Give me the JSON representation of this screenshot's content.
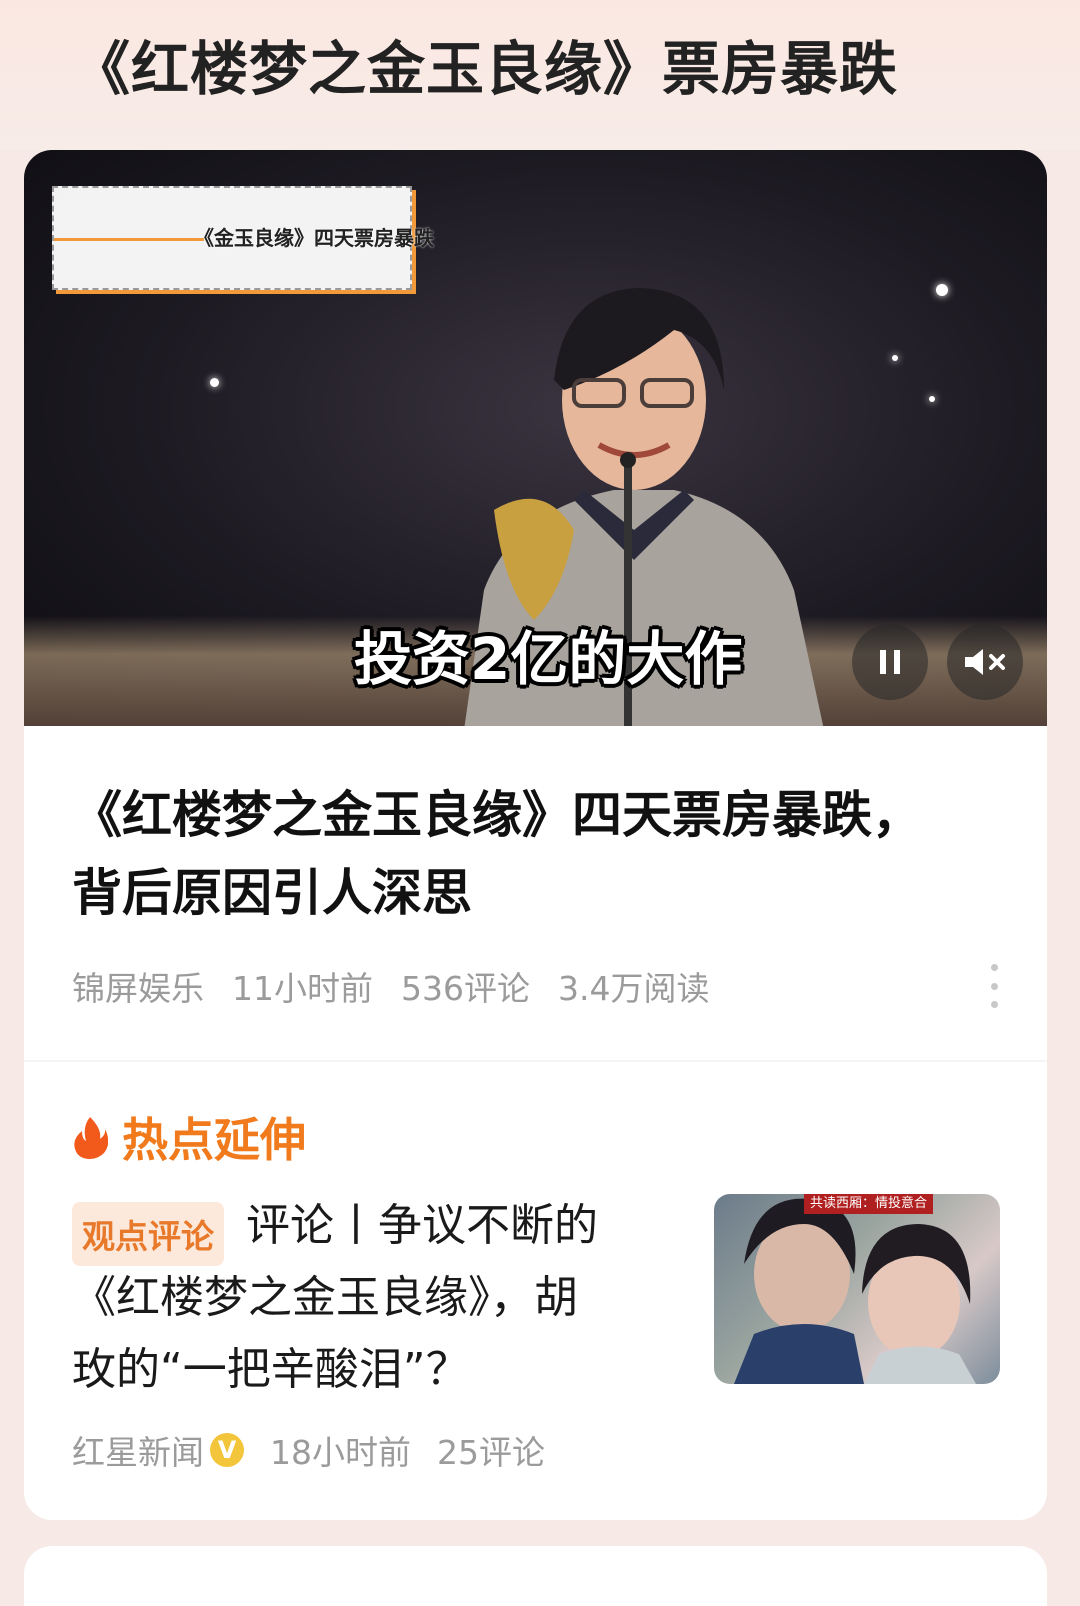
{
  "page": {
    "title": "《红楼梦之金玉良缘》票房暴跌"
  },
  "video": {
    "overlay_caption": "《金玉良缘》四天票房暴跌",
    "subtitle": "投资2亿的大作"
  },
  "article": {
    "title_line1": "《红楼梦之金玉良缘》四天票房暴跌，",
    "title_line2": "背后原因引人深思",
    "source": "锦屏娱乐",
    "time": "11小时前",
    "comments": "536评论",
    "reads": "3.4万阅读"
  },
  "hot": {
    "label": "热点延伸",
    "related": {
      "tag": "观点评论",
      "title_line1": "评论丨争议不断的",
      "title_line2": "《红楼梦之金玉良缘》，胡",
      "title_line3": "玫的“一把辛酸泪”？",
      "thumb_banner": "共读西厢：情投意合",
      "source": "红星新闻",
      "verified_badge": "V",
      "time": "18小时前",
      "comments": "25评论"
    }
  },
  "colors": {
    "accent": "#f07a1c",
    "tag_bg": "#fde9dc",
    "meta": "#9b9b9b"
  }
}
